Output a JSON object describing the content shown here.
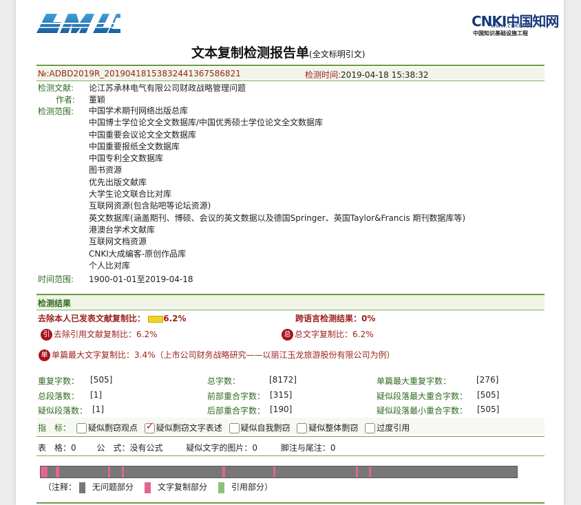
{
  "header": {
    "left_logo": "AMLC",
    "right_logo_main": "CNKI中国知网",
    "right_logo_url": "www.cnki.net",
    "right_logo_sub": "中国知识基础设施工程",
    "title": "文本复制检测报告单",
    "title_note": "(全文标明引文)"
  },
  "info": {
    "report_no_label": "№:",
    "report_no": "ADBD2019R_2019041815383244136758682​1",
    "check_time_label": "检测时间:",
    "check_time": "2019-04-18 15:38:32",
    "doc_label": "检测文献:",
    "doc_title": "论江苏承林电气有限公司财政战略管理问题",
    "author_label": "作者:",
    "author": "董颖",
    "scope_label": "检测范围:",
    "scope": [
      "中国学术期刊网络出版总库",
      "中国博士学位论文全文数据库/中国优秀硕士学位论文全文数据库",
      "中国重要会议论文全文数据库",
      "中国重要报纸全文数据库",
      "中国专利全文数据库",
      "图书资源",
      "优先出版文献库",
      "大学生论文联合比对库",
      "互联网资源(包含贴吧等论坛资源)",
      "英文数据库(涵盖期刊、博硕、会议的英文数据以及德国Springer、英国Taylor&Francis 期刊数据库等)",
      "港澳台学术文献库",
      "互联网文档资源",
      "CNKI大成编客-原创作品库",
      "个人比对库"
    ],
    "time_range_label": "时间范围:",
    "time_range": "1900-01-01至2019-04-18"
  },
  "results": {
    "section_title": "检测结果",
    "remove_self_label": "去除本人已发表文献复制比：",
    "remove_self_value": "6.2%",
    "cross_lang_label": "跨语言检测结果：",
    "cross_lang_value": "0%",
    "remove_quote_icon": "引",
    "remove_quote_label": "去除引用文献复制比：",
    "remove_quote_value": "6.2%",
    "total_icon": "总",
    "total_label": "总文字复制比：",
    "total_value": "6.2%",
    "single_icon": "单",
    "single_label": "单篇最大文字复制比：",
    "single_value": "3.4%",
    "single_source": "（上市公司财务战略研究——以丽江玉龙旅游股份有限公司为例）",
    "stats": {
      "dup_chars_label": "重复字数：",
      "dup_chars": "[505]",
      "total_chars_label": "总字数：",
      "total_chars": "[8172]",
      "single_max_dup_label": "单篇最大重复字数：",
      "single_max_dup": "[276]",
      "total_paras_label": "总段落数：",
      "total_paras": "[1]",
      "front_overlap_label": "前部重合字数：",
      "front_overlap": "[315]",
      "max_para_overlap_label": "疑似段落最大重合字数：",
      "max_para_overlap": "[505]",
      "sus_paras_label": "疑似段落数：",
      "sus_paras": "[1]",
      "back_overlap_label": "后部重合字数：",
      "back_overlap": "[190]",
      "min_para_overlap_label": "疑似段落最小重合字数：",
      "min_para_overlap": "[505]"
    },
    "indicator_label": "指　标：",
    "indicators": [
      {
        "label": "疑似剽窃观点",
        "checked": false
      },
      {
        "label": "疑似剽窃文字表述",
        "checked": true
      },
      {
        "label": "疑似自我剽窃",
        "checked": false
      },
      {
        "label": "疑似整体剽窃",
        "checked": false
      },
      {
        "label": "过度引用",
        "checked": false
      }
    ],
    "misc": {
      "table_label": "表　格：",
      "table_value": "0",
      "formula_label": "公　式：",
      "formula_value": "没有公式",
      "images_label": "疑似文字的图片：",
      "images_value": "0",
      "notes_label": "脚注与尾注：",
      "notes_value": "0"
    },
    "legend": {
      "prefix": "（注释：",
      "ok": "无问题部分",
      "copy": "文字复制部分",
      "quote": "引用部分",
      "suffix": "）"
    },
    "colors": {
      "ok": "#777777",
      "copy": "#e2668a",
      "quote": "#8dc07a"
    }
  }
}
